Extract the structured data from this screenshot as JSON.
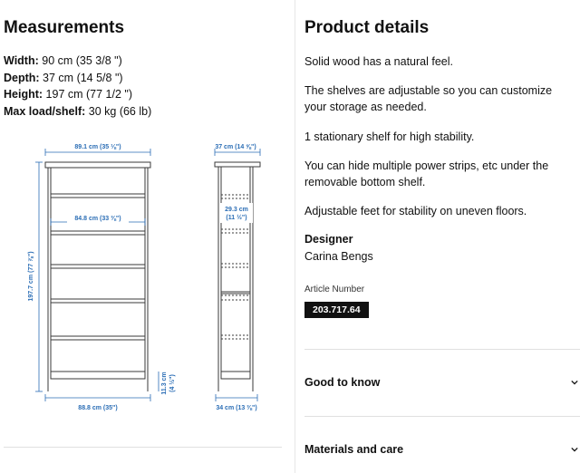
{
  "measurements": {
    "heading": "Measurements",
    "rows": [
      {
        "label": "Width:",
        "value": " 90 cm (35 3/8 \")"
      },
      {
        "label": "Depth:",
        "value": " 37 cm (14 5/8 \")"
      },
      {
        "label": "Height:",
        "value": " 197 cm (77 1/2 \")"
      },
      {
        "label": "Max load/shelf:",
        "value": " 30 kg (66 lb)"
      }
    ],
    "diagram": {
      "top_width": "89.1 cm (35 ⅛\")",
      "inner_width": "84.8 cm (33 ⅜\")",
      "height": "197.7 cm (77 ⅞\")",
      "bottom_width": "88.8 cm (35\")",
      "foot_height_cm": "11.3 cm",
      "foot_height_in": "(4 ½\")",
      "top_depth": "37 cm (14 ⅝\")",
      "shelf_gap_cm": "29.3 cm",
      "shelf_gap_in": "(11 ½\")",
      "bottom_depth": "34 cm (13 ⅜\")",
      "line_color": "#3a3a3a",
      "dim_color": "#2a6db5"
    }
  },
  "details": {
    "heading": "Product details",
    "paragraphs": [
      "Solid wood has a natural feel.",
      "The shelves are adjustable so you can customize your storage as needed.",
      "1 stationary shelf for high stability.",
      "You can hide multiple power strips, etc under the removable bottom shelf.",
      "Adjustable feet for stability on uneven floors."
    ],
    "designer_label": "Designer",
    "designer_name": "Carina Bengs",
    "article_label": "Article Number",
    "article_number": "203.717.64"
  },
  "accordions": [
    {
      "label": "Good to know",
      "icon": "chevron-down-icon"
    },
    {
      "label": "Materials and care",
      "icon": "chevron-down-icon"
    }
  ]
}
